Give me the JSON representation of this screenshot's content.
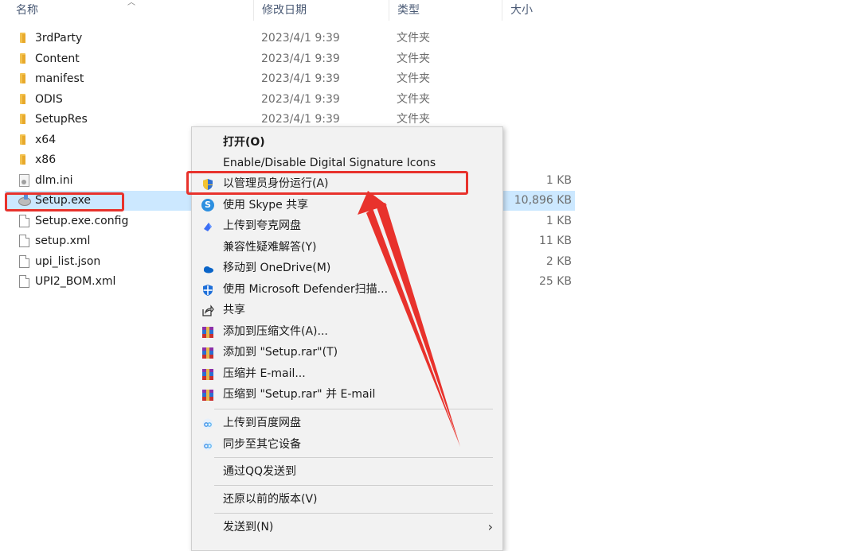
{
  "header": {
    "name": "名称",
    "date": "修改日期",
    "type": "类型",
    "size": "大小"
  },
  "files": [
    {
      "name": "3rdParty",
      "date": "2023/4/1 9:39",
      "type": "文件夹",
      "size": "",
      "icon": "folder-icon"
    },
    {
      "name": "Content",
      "date": "2023/4/1 9:39",
      "type": "文件夹",
      "size": "",
      "icon": "folder-icon"
    },
    {
      "name": "manifest",
      "date": "2023/4/1 9:39",
      "type": "文件夹",
      "size": "",
      "icon": "folder-icon"
    },
    {
      "name": "ODIS",
      "date": "2023/4/1 9:39",
      "type": "文件夹",
      "size": "",
      "icon": "folder-icon"
    },
    {
      "name": "SetupRes",
      "date": "2023/4/1 9:39",
      "type": "文件夹",
      "size": "",
      "icon": "folder-icon"
    },
    {
      "name": "x64",
      "date": "",
      "type": "",
      "size": "",
      "icon": "folder-icon"
    },
    {
      "name": "x86",
      "date": "",
      "type": "",
      "size": "",
      "icon": "folder-icon"
    },
    {
      "name": "dlm.ini",
      "date": "",
      "type": "",
      "size": "1 KB",
      "icon": "ini-file-icon"
    },
    {
      "name": "Setup.exe",
      "date": "",
      "type": "",
      "size": "10,896 KB",
      "icon": "exe-file-icon",
      "selected": true
    },
    {
      "name": "Setup.exe.config",
      "date": "",
      "type": "",
      "size": "1 KB",
      "icon": "document-icon"
    },
    {
      "name": "setup.xml",
      "date": "",
      "type": "",
      "size": "11 KB",
      "icon": "document-icon"
    },
    {
      "name": "upi_list.json",
      "date": "",
      "type": "",
      "size": "2 KB",
      "icon": "document-icon"
    },
    {
      "name": "UPI2_BOM.xml",
      "date": "",
      "type": "",
      "size": "25 KB",
      "icon": "document-icon"
    }
  ],
  "menu": {
    "open": "打开(O)",
    "digital_sig": "Enable/Disable Digital Signature Icons",
    "run_as_admin": "以管理员身份运行(A)",
    "skype_share": "使用 Skype 共享",
    "upload_quark": "上传到夸克网盘",
    "compat": "兼容性疑难解答(Y)",
    "onedrive": "移动到 OneDrive(M)",
    "defender": "使用 Microsoft Defender扫描...",
    "share": "共享",
    "add_archive": "添加到压缩文件(A)...",
    "add_setup_rar": "添加到 \"Setup.rar\"(T)",
    "compress_email": "压缩并 E-mail...",
    "compress_setup_email": "压缩到 \"Setup.rar\" 并 E-mail",
    "upload_baidu": "上传到百度网盘",
    "sync_devices": "同步至其它设备",
    "qq_send": "通过QQ发送到",
    "restore": "还原以前的版本(V)",
    "send_to": "发送到(N)",
    "skype_letter": "S"
  },
  "colors": {
    "selection": "#cce8ff",
    "highlight_red": "#e8322c",
    "menu_bg": "#f2f2f2"
  }
}
